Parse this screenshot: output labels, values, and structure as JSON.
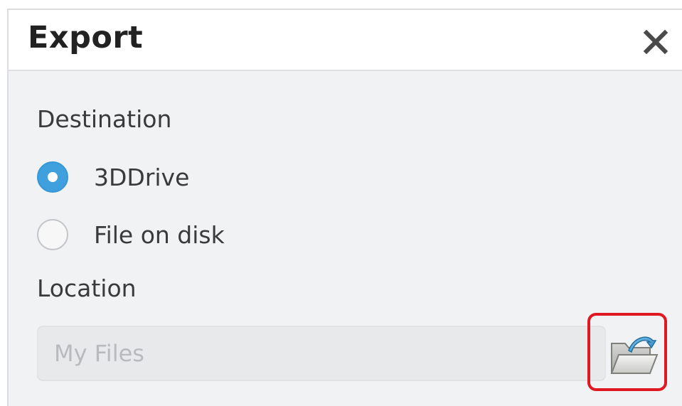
{
  "dialog": {
    "title": "Export",
    "close_icon": "close-icon"
  },
  "destination": {
    "label": "Destination",
    "options": [
      {
        "label": "3DDrive",
        "selected": true
      },
      {
        "label": "File on disk",
        "selected": false
      }
    ]
  },
  "location": {
    "label": "Location",
    "placeholder": "My Files",
    "browse_icon": "folder-open-icon"
  },
  "colors": {
    "accent": "#3fa0dd",
    "highlight": "#e01822",
    "panel_bg": "#f1f2f4",
    "header_bg": "#ffffff"
  }
}
